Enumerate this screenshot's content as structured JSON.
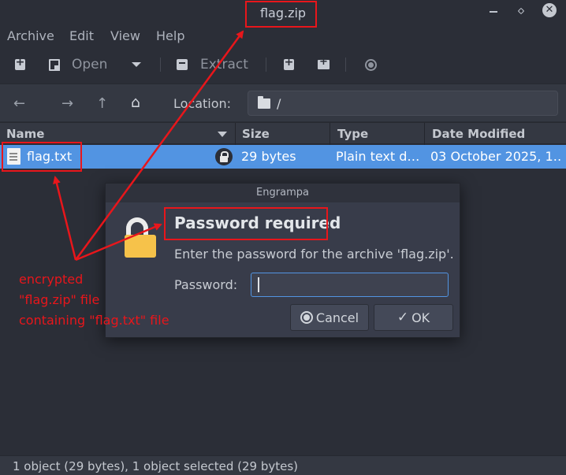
{
  "window": {
    "title": "flag.zip"
  },
  "menu": {
    "archive": "Archive",
    "edit": "Edit",
    "view": "View",
    "help": "Help"
  },
  "toolbar": {
    "open": "Open",
    "extract": "Extract"
  },
  "location": {
    "label": "Location:",
    "path": "/"
  },
  "columns": {
    "name": "Name",
    "size": "Size",
    "type": "Type",
    "date": "Date Modified"
  },
  "files": [
    {
      "name": "flag.txt",
      "size": "29 bytes",
      "type": "Plain text d…",
      "date": "03 October 2025, 1…",
      "encrypted": true
    }
  ],
  "status": "1 object (29 bytes), 1 object selected (29 bytes)",
  "dialog": {
    "title": "Engrampa",
    "heading": "Password required",
    "message": "Enter the password for the archive 'flag.zip'.",
    "password_label": "Password:",
    "password_value": "",
    "cancel": "Cancel",
    "ok": "OK"
  },
  "annotation": {
    "line1": "encrypted",
    "line2": "\"flag.zip\" file",
    "line3": "containing \"flag.txt\" file"
  },
  "colors": {
    "accent": "#5294e2",
    "annotation": "#e8161b",
    "background": "#2b2e37"
  },
  "icons": [
    "new-archive-icon",
    "open-icon",
    "extract-icon",
    "add-files-icon",
    "add-folder-icon",
    "stop-icon",
    "back-icon",
    "forward-icon",
    "up-icon",
    "home-icon",
    "folder-icon",
    "text-file-icon",
    "lock-icon",
    "padlock-icon",
    "cancel-icon",
    "check-icon"
  ]
}
